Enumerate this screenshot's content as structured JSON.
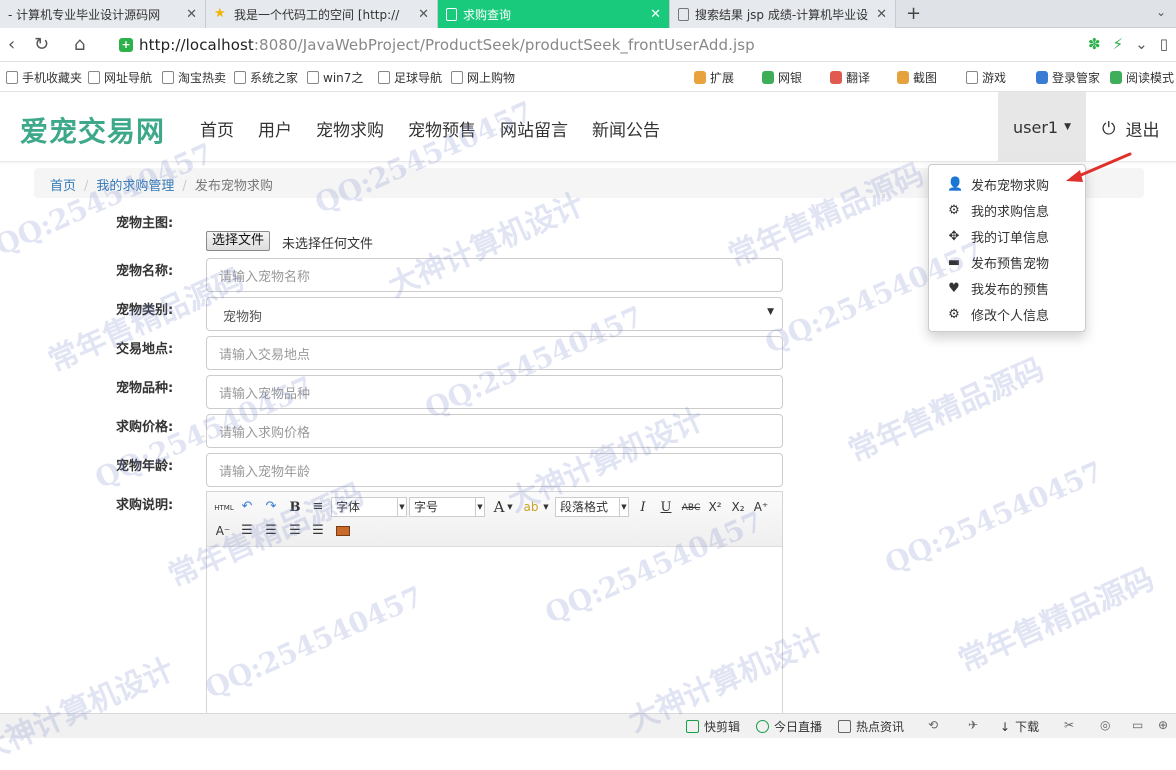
{
  "browser": {
    "tabs": [
      {
        "label": "- 计算机专业毕业设计源码网",
        "active": false
      },
      {
        "label": "我是一个代码工的空间 [http://",
        "active": false
      },
      {
        "label": "求购查询",
        "active": true
      },
      {
        "label": "搜索结果 jsp 成绩-计算机毕业设",
        "active": false
      }
    ],
    "new_tab": "+",
    "url_host": "http://localhost",
    "url_path": ":8080/JavaWebProject/ProductSeek/productSeek_frontUserAdd.jsp",
    "bookmarks": [
      "手机收藏夹",
      "网址导航",
      "淘宝热卖",
      "系统之家",
      "win7之",
      "足球导航",
      "网上购物"
    ],
    "toolbar_right": [
      "扩展",
      "网银",
      "翻译",
      "截图",
      "游戏",
      "登录管家",
      "阅读模式"
    ]
  },
  "site": {
    "logo": "爱宠交易网",
    "nav": [
      "首页",
      "用户",
      "宠物求购",
      "宠物预售",
      "网站留言",
      "新闻公告"
    ],
    "user": "user1",
    "logout": "退出",
    "user_dropdown": [
      {
        "label": "发布宠物求购",
        "icon": "user-icon"
      },
      {
        "label": "我的求购信息",
        "icon": "gear-icon"
      },
      {
        "label": "我的订单信息",
        "icon": "move-icon"
      },
      {
        "label": "发布预售宠物",
        "icon": "card-icon"
      },
      {
        "label": "我发布的预售",
        "icon": "heart-icon"
      },
      {
        "label": "修改个人信息",
        "icon": "gear-icon"
      }
    ]
  },
  "breadcrumb": [
    "首页",
    "我的求购管理",
    "发布宠物求购"
  ],
  "form": {
    "main_image_label": "宠物主图:",
    "file_button": "选择文件",
    "file_status": "未选择任何文件",
    "name_label": "宠物名称:",
    "name_placeholder": "请输入宠物名称",
    "category_label": "宠物类别:",
    "category_value": "宠物狗",
    "location_label": "交易地点:",
    "location_placeholder": "请输入交易地点",
    "breed_label": "宠物品种:",
    "breed_placeholder": "请输入宠物品种",
    "price_label": "求购价格:",
    "price_placeholder": "请输入求购价格",
    "age_label": "宠物年龄:",
    "age_placeholder": "请输入宠物年龄",
    "desc_label": "求购说明:"
  },
  "editor": {
    "html_btn": "HTML",
    "bold": "B",
    "font": "字体",
    "size": "字号",
    "font_color": "A",
    "paragraph": "段落格式",
    "italic": "I",
    "underline": "U",
    "strike": "ABC",
    "sup": "X²",
    "sub": "X₂"
  },
  "statusbar": [
    "快剪辑",
    "今日直播",
    "热点资讯",
    "下载"
  ],
  "watermarks": [
    "QQ:254540457",
    "常年售精品源码",
    "大神计算机设计"
  ],
  "colors": {
    "accent": "#19c97c",
    "logo": "#3ea88a",
    "link": "#337ab7",
    "annotation": "#e0302c"
  }
}
